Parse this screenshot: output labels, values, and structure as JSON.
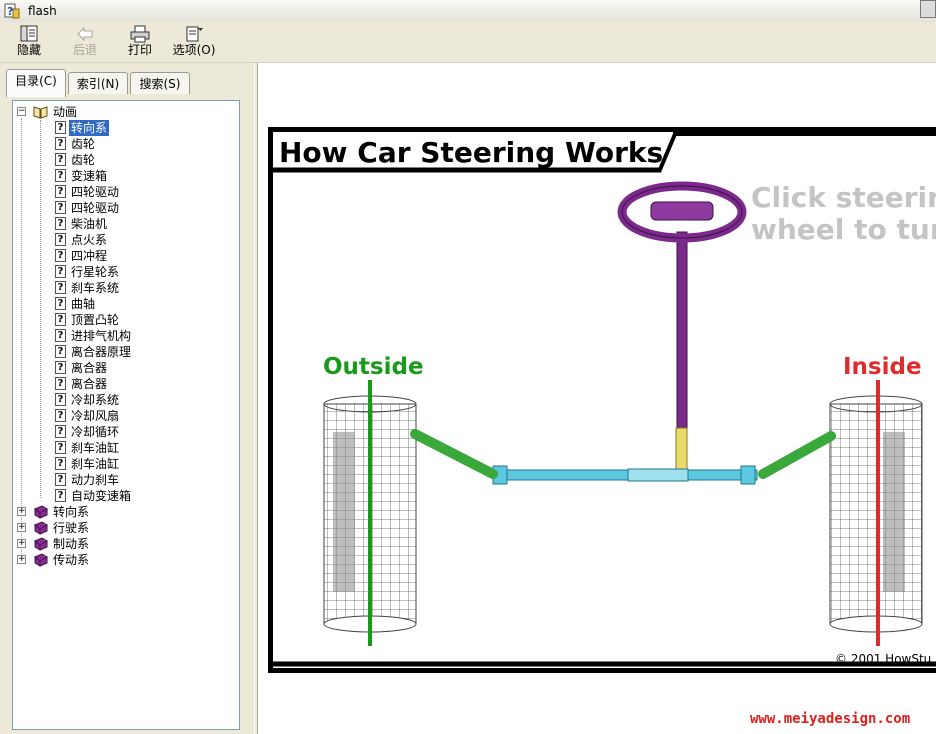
{
  "window": {
    "title": "flash"
  },
  "toolbar": {
    "hide": "隐藏",
    "back": "后退",
    "print": "打印",
    "options": "选项(O)"
  },
  "tabs": {
    "contents": "目录(C)",
    "index": "索引(N)",
    "search": "搜索(S)"
  },
  "tree": {
    "root": "动画",
    "items": [
      "转向系",
      "齿轮",
      "齿轮",
      "变速箱",
      "四轮驱动",
      "四轮驱动",
      "柴油机",
      "点火系",
      "四冲程",
      "行星轮系",
      "刹车系统",
      "曲轴",
      "顶置凸轮",
      "进排气机构",
      "离合器原理",
      "离合器",
      "离合器",
      "冷却系统",
      "冷却风扇",
      "冷却循环",
      "刹车油缸",
      "刹车油缸",
      "动力刹车",
      "自动变速箱"
    ],
    "books": [
      "转向系",
      "行驶系",
      "制动系",
      "传动系"
    ]
  },
  "flash": {
    "title": "How Car Steering Works",
    "hint_line1": "Click steerin",
    "hint_line2": "wheel to tur",
    "outside": "Outside",
    "inside": "Inside",
    "copyright": "© 2001 HowStu"
  },
  "watermark": "www.meiyadesign.com",
  "colors": {
    "outside": "#1a9a1a",
    "inside": "#e02b2b",
    "wheel": "#7b2a8c",
    "rack": "#5cc9e0",
    "tie_rod": "#3aa83a",
    "selection": "#316ac5"
  }
}
